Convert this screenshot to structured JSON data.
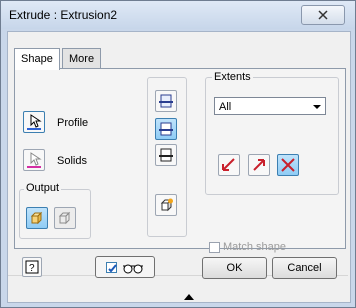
{
  "window": {
    "title": "Extrude : Extrusion2"
  },
  "tabs": [
    {
      "label": "Shape"
    },
    {
      "label": "More"
    }
  ],
  "shape": {
    "profile_label": "Profile",
    "solids_label": "Solids",
    "output_title": "Output"
  },
  "extents": {
    "title": "Extents",
    "selected": "All",
    "match_shape_label": "Match shape"
  },
  "footer": {
    "ok_label": "OK",
    "cancel_label": "Cancel"
  },
  "colors": {
    "accent": "#3c7fb1",
    "pressed_bg": "#9fd4f7",
    "profile_underline": "#2e62d4",
    "solids_underline": "#d42ea4"
  }
}
